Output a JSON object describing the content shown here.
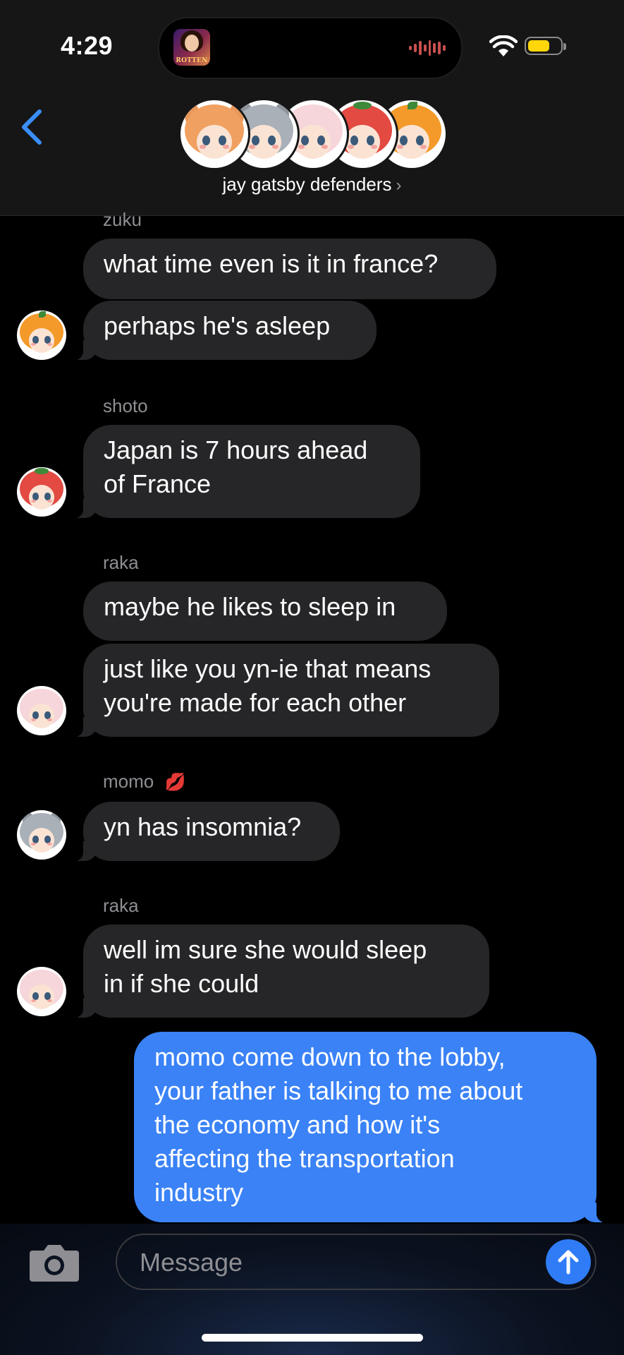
{
  "status_bar": {
    "time": "4:29",
    "now_playing_art_text": "ROTTEN"
  },
  "header": {
    "group_name": "jay gatsby defenders",
    "chevron": "›"
  },
  "messages": [
    {
      "sender": "zuku"
    },
    {
      "text": "what time even is it in france?"
    },
    {
      "text": "perhaps he's asleep"
    },
    {
      "sender": "shoto"
    },
    {
      "text": "Japan is 7 hours ahead\nof France"
    },
    {
      "sender": "raka"
    },
    {
      "text": "maybe he likes to sleep in"
    },
    {
      "text": "just like you yn-ie that means\nyou're made for each other"
    },
    {
      "sender": "momo",
      "emoji": "💋"
    },
    {
      "text": "yn has insomnia?"
    },
    {
      "sender": "raka"
    },
    {
      "text": "well im sure she would sleep\nin if she could"
    },
    {
      "text": "momo come down to the lobby,\nyour father is talking to me about\nthe economy and how it's\naffecting the transportation\nindustry"
    }
  ],
  "composer": {
    "placeholder": "Message"
  },
  "colors": {
    "accent": "#3a82f6",
    "bubble_gray": "#262628",
    "send": "#2f7cf6"
  },
  "icons": [
    "back-chevron-icon",
    "wifi-icon",
    "battery-icon",
    "camera-icon",
    "send-arrow-icon"
  ]
}
